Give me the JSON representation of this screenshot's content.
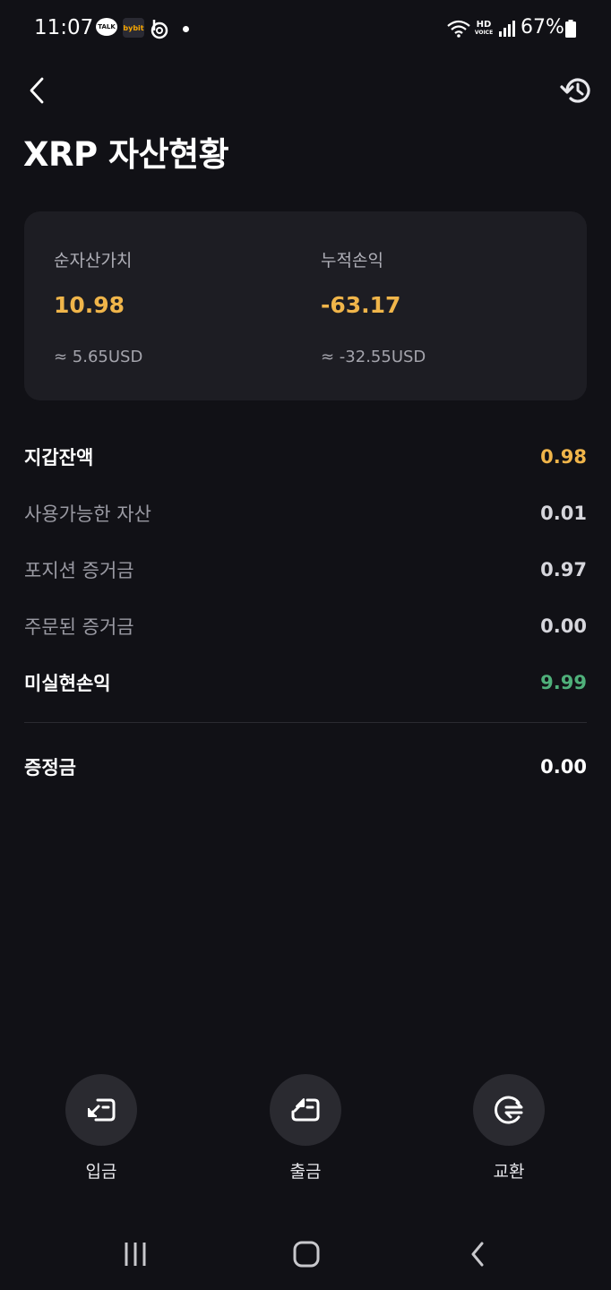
{
  "status_bar": {
    "time": "11:07",
    "talk_badge": "TALK",
    "bybit_badge": "bybit",
    "hd_label": "HD",
    "voice_label": "VOICE",
    "battery": "67%",
    "icons": [
      "kakaotalk-icon",
      "bybit-icon",
      "b-app-icon",
      "notification-dot-icon",
      "wifi-icon",
      "hd-voice-icon",
      "signal-icon",
      "battery-icon"
    ]
  },
  "header": {
    "title": "XRP 자산현황",
    "back_icon": "chevron-left-icon",
    "history_icon": "history-icon"
  },
  "summary": {
    "net_asset_label": "순자산가치",
    "net_asset_value": "10.98",
    "net_asset_usd": "≈ 5.65USD",
    "pnl_label": "누적손익",
    "pnl_value": "-63.17",
    "pnl_usd": "≈ -32.55USD",
    "value_color": "#f0b54a"
  },
  "balances": [
    {
      "label": "지갑잔액",
      "value": "0.98"
    },
    {
      "label": "사용가능한 자산",
      "value": "0.01"
    },
    {
      "label": "포지션 증거금",
      "value": "0.97"
    },
    {
      "label": "주문된 증거금",
      "value": "0.00"
    },
    {
      "label": "미실현손익",
      "value": "9.99"
    }
  ],
  "bonus": {
    "label": "증정금",
    "value": "0.00"
  },
  "actions": [
    {
      "label": "입금",
      "icon": "deposit-icon"
    },
    {
      "label": "출금",
      "icon": "withdraw-icon"
    },
    {
      "label": "교환",
      "icon": "convert-icon"
    }
  ],
  "colors": {
    "background": "#111116",
    "card": "#1d1d23",
    "gold": "#f0b54a",
    "green": "#4fb07a"
  }
}
